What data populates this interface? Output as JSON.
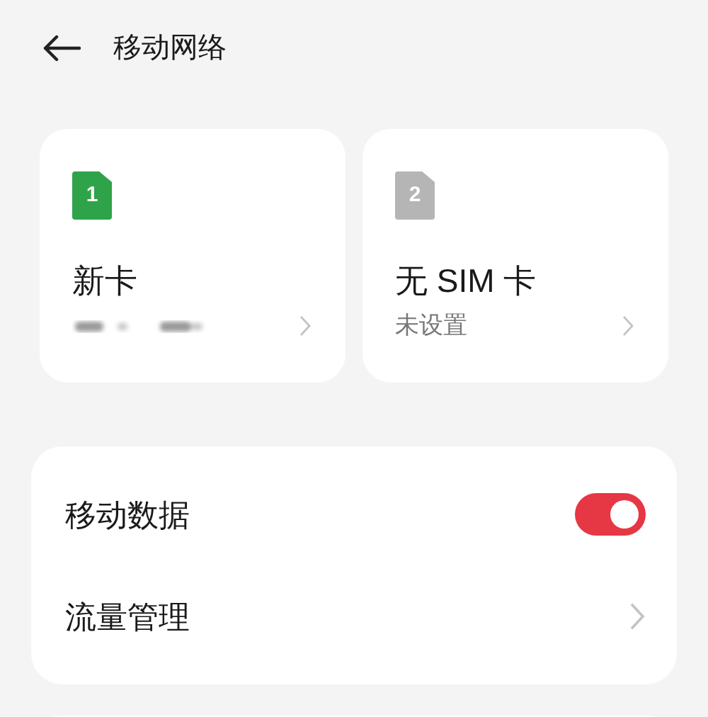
{
  "header": {
    "title": "移动网络"
  },
  "sim_cards": [
    {
      "slot": "1",
      "active": true,
      "name": "新卡",
      "masked": true
    },
    {
      "slot": "2",
      "active": false,
      "name": "无 SIM 卡",
      "masked": false,
      "subtitle": "未设置"
    }
  ],
  "settings": [
    {
      "kind": "toggle",
      "label": "移动数据",
      "on": true
    },
    {
      "kind": "link",
      "label": "流量管理"
    }
  ]
}
